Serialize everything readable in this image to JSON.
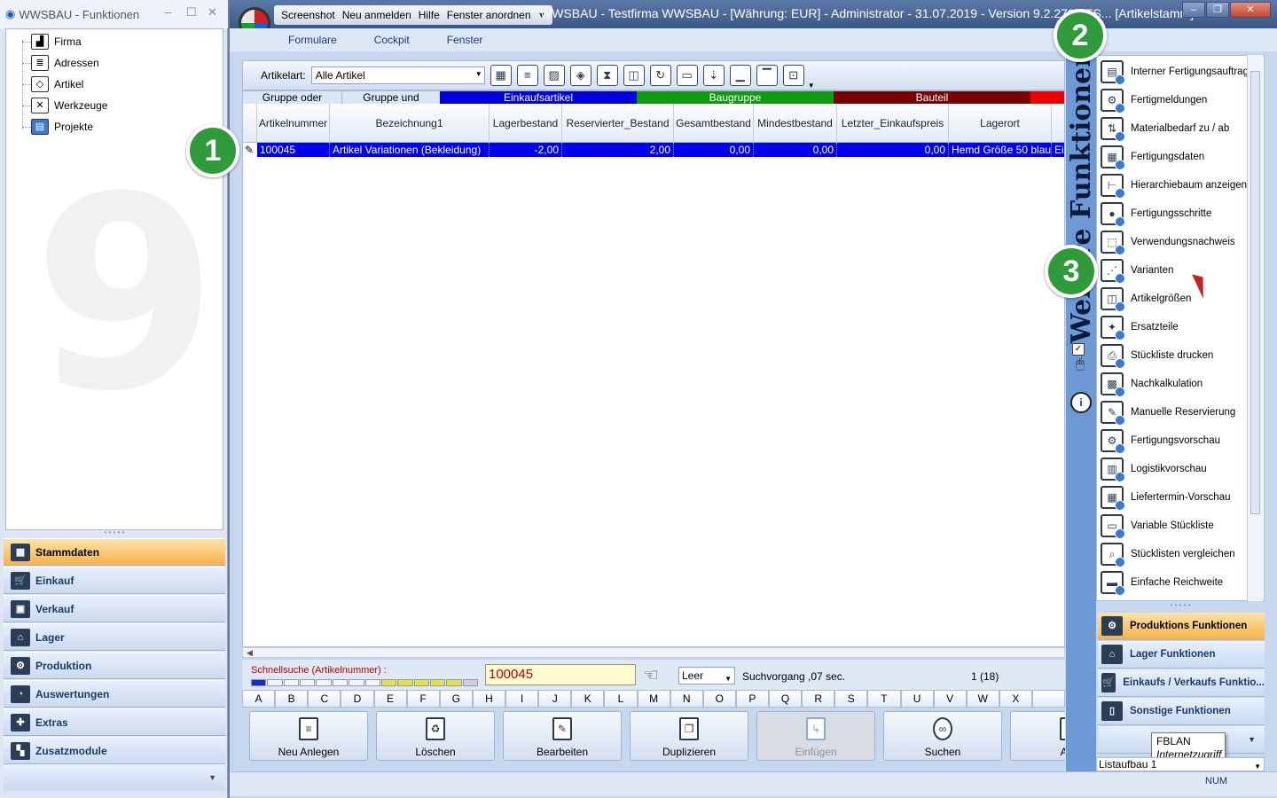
{
  "left_window": {
    "title": "WWSBAU - Funktionen",
    "window_controls": [
      "–",
      "☐",
      "✕"
    ],
    "tree": [
      {
        "label": "Firma",
        "icon": "factory-icon"
      },
      {
        "label": "Adressen",
        "icon": "address-card-icon"
      },
      {
        "label": "Artikel",
        "icon": "box-icon"
      },
      {
        "label": "Werkzeuge",
        "icon": "tools-icon"
      },
      {
        "label": "Projekte",
        "icon": "project-icon"
      }
    ],
    "nav": [
      {
        "label": "Stammdaten",
        "icon": "master-data-icon",
        "active": true
      },
      {
        "label": "Einkauf",
        "icon": "cart-icon",
        "active": false
      },
      {
        "label": "Verkauf",
        "icon": "cash-register-icon",
        "active": false
      },
      {
        "label": "Lager",
        "icon": "warehouse-icon",
        "active": false
      },
      {
        "label": "Produktion",
        "icon": "production-icon",
        "active": false
      },
      {
        "label": "Auswertungen",
        "icon": "analytics-icon",
        "active": false
      },
      {
        "label": "Extras",
        "icon": "extras-icon",
        "active": false
      },
      {
        "label": "Zusatzmodule",
        "icon": "modules-icon",
        "active": false
      }
    ]
  },
  "main_window": {
    "quick_access": [
      "Screenshot",
      "Neu anmelden",
      "Hilfe",
      "Fenster anordnen"
    ],
    "title": "WWSBAU - Testfirma WWSBAU - [Währung: EUR] - Administrator - 31.07.2019 - Version 9.2.270 - TS... [Artikelstamm]",
    "window_controls": [
      "–",
      "❐",
      "✕"
    ],
    "menu": [
      "Formulare",
      "Cockpit",
      "Fenster"
    ]
  },
  "toolbar": {
    "artikelart_label": "Artikelart:",
    "artikelart_value": "Alle Artikel"
  },
  "grid": {
    "groups": [
      {
        "label": "Gruppe oder",
        "color": "#dbe6f4",
        "text": "#000000"
      },
      {
        "label": "Gruppe und",
        "color": "#dbe6f4",
        "text": "#000000"
      },
      {
        "label": "Einkaufsartikel",
        "color": "#0000dd",
        "text": "#ffffff"
      },
      {
        "label": "Baugruppe",
        "color": "#109a10",
        "text": "#ffffff"
      },
      {
        "label": "Bauteil",
        "color": "#7a0000",
        "text": "#ffffff"
      },
      {
        "label": "",
        "color": "#ee0000",
        "text": "#ffffff"
      }
    ],
    "columns": [
      "Artikelnummer",
      "Bezeichnung1",
      "Lagerbestand",
      "Reservierter_Bestand",
      "Gesamtbestand",
      "Mindestbestand",
      "Letzter_Einkaufspreis",
      "Lagerort",
      ""
    ],
    "rows": [
      [
        "100045",
        "Artikel Variationen (Bekleidung)",
        "-2,00",
        "2,00",
        "0,00",
        "0,00",
        "0,00",
        "Hemd Größe 50 blau",
        "Ein"
      ]
    ]
  },
  "search": {
    "label": "Schnellsuche (Artikelnummer) :",
    "value": "100045",
    "mode": "Leer",
    "info": "Suchvorgang ,07 sec.",
    "count": "1  (18)"
  },
  "letters": [
    "A",
    "B",
    "C",
    "D",
    "E",
    "F",
    "G",
    "H",
    "I",
    "J",
    "K",
    "L",
    "M",
    "N",
    "O",
    "P",
    "Q",
    "R",
    "S",
    "T",
    "U",
    "V",
    "W",
    "X",
    ""
  ],
  "actions": [
    {
      "label": "Neu Anlegen",
      "icon": "new-document-icon",
      "enabled": true
    },
    {
      "label": "Löschen",
      "icon": "trash-icon",
      "enabled": true
    },
    {
      "label": "Bearbeiten",
      "icon": "edit-icon",
      "enabled": true
    },
    {
      "label": "Duplizieren",
      "icon": "duplicate-icon",
      "enabled": true
    },
    {
      "label": "Einfügen",
      "icon": "paste-icon",
      "enabled": false
    },
    {
      "label": "Suchen",
      "icon": "binoculars-icon",
      "enabled": true
    },
    {
      "label": "Aus",
      "icon": "print-icon",
      "enabled": true
    }
  ],
  "status": {
    "num": "NUM"
  },
  "side_panel": {
    "vertical_title": "Weitere Funktionen",
    "functions": [
      "Interner Fertigungsauftrag",
      "Fertigmeldungen",
      "Materialbedarf zu / ab",
      "Fertigungsdaten",
      "Hierarchiebaum anzeigen",
      "Fertigungsschritte",
      "Verwendungsnachweis",
      "Varianten",
      "Artikelgrößen",
      "Ersatzteile",
      "Stückliste drucken",
      "Nachkalkulation",
      "Manuelle Reservierung",
      "Fertigungsvorschau",
      "Logistikvorschau",
      "Liefertermin-Vorschau",
      "Variable Stückliste",
      "Stücklisten vergleichen",
      "Einfache Reichweite"
    ],
    "categories": [
      {
        "label": "Produktions Funktionen",
        "active": true
      },
      {
        "label": "Lager Funktionen",
        "active": false
      },
      {
        "label": "Einkaufs / Verkaufs Funktio...",
        "active": false
      },
      {
        "label": "Sonstige Funktionen",
        "active": false
      }
    ],
    "tooltip": {
      "line1": "FBLAN",
      "line2": "Internetzugriff"
    },
    "listaufbau": "Listaufbau 1"
  },
  "markers": [
    "1",
    "2",
    "3"
  ]
}
